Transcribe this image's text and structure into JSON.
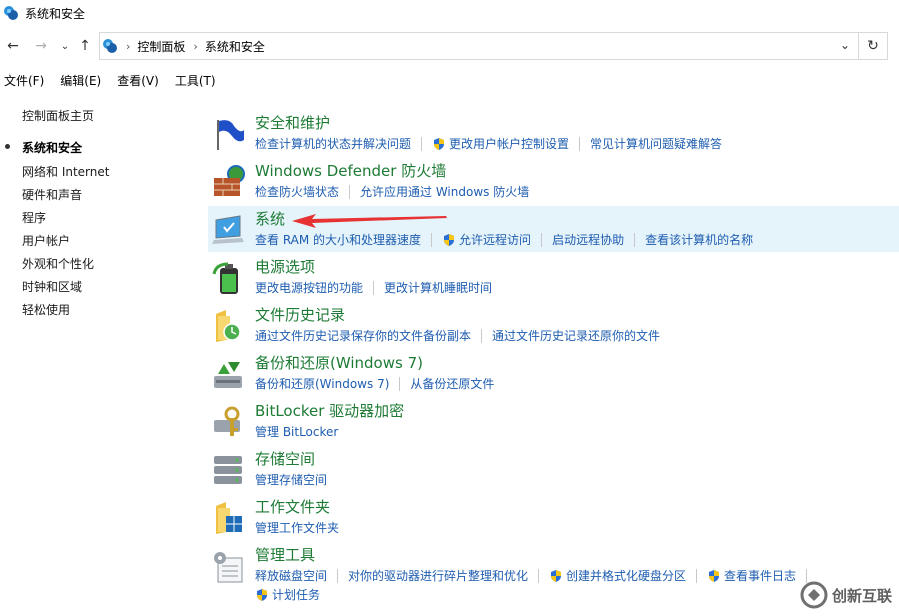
{
  "window": {
    "title": "系统和安全"
  },
  "nav": {
    "breadcrumb": [
      "控制面板",
      "系统和安全"
    ]
  },
  "menu": [
    "文件(F)",
    "编辑(E)",
    "查看(V)",
    "工具(T)"
  ],
  "sidebar": {
    "items": [
      "控制面板主页",
      "系统和安全",
      "网络和 Internet",
      "硬件和声音",
      "程序",
      "用户帐户",
      "外观和个性化",
      "时钟和区域",
      "轻松使用"
    ],
    "active_index": 1
  },
  "categories": [
    {
      "title": "安全和维护",
      "icon": "flag-icon",
      "links": [
        {
          "label": "检查计算机的状态并解决问题",
          "shield": false
        },
        {
          "label": "更改用户帐户控制设置",
          "shield": true
        },
        {
          "label": "常见计算机问题疑难解答",
          "shield": false
        }
      ]
    },
    {
      "title": "Windows Defender 防火墙",
      "icon": "firewall-icon",
      "links": [
        {
          "label": "检查防火墙状态",
          "shield": false
        },
        {
          "label": "允许应用通过 Windows 防火墙",
          "shield": false
        }
      ]
    },
    {
      "title": "系统",
      "icon": "computer-icon",
      "highlight": true,
      "links": [
        {
          "label": "查看 RAM 的大小和处理器速度",
          "shield": false
        },
        {
          "label": "允许远程访问",
          "shield": true
        },
        {
          "label": "启动远程协助",
          "shield": false
        },
        {
          "label": "查看该计算机的名称",
          "shield": false
        }
      ]
    },
    {
      "title": "电源选项",
      "icon": "battery-icon",
      "links": [
        {
          "label": "更改电源按钮的功能",
          "shield": false
        },
        {
          "label": "更改计算机睡眠时间",
          "shield": false
        }
      ]
    },
    {
      "title": "文件历史记录",
      "icon": "folder-clock-icon",
      "links": [
        {
          "label": "通过文件历史记录保存你的文件备份副本",
          "shield": false
        },
        {
          "label": "通过文件历史记录还原你的文件",
          "shield": false
        }
      ]
    },
    {
      "title": "备份和还原(Windows 7)",
      "icon": "backup-icon",
      "links": [
        {
          "label": "备份和还原(Windows 7)",
          "shield": false
        },
        {
          "label": "从备份还原文件",
          "shield": false
        }
      ]
    },
    {
      "title": "BitLocker 驱动器加密",
      "icon": "bitlocker-icon",
      "links": [
        {
          "label": "管理 BitLocker",
          "shield": false
        }
      ]
    },
    {
      "title": "存储空间",
      "icon": "storage-icon",
      "links": [
        {
          "label": "管理存储空间",
          "shield": false
        }
      ]
    },
    {
      "title": "工作文件夹",
      "icon": "work-folder-icon",
      "links": [
        {
          "label": "管理工作文件夹",
          "shield": false
        }
      ]
    },
    {
      "title": "管理工具",
      "icon": "admin-tools-icon",
      "links": [
        {
          "label": "释放磁盘空间",
          "shield": false
        },
        {
          "label": "对你的驱动器进行碎片整理和优化",
          "shield": false
        },
        {
          "label": "创建并格式化硬盘分区",
          "shield": true
        },
        {
          "label": "查看事件日志",
          "shield": true
        }
      ],
      "links_row2": [
        {
          "label": "计划任务",
          "shield": true
        }
      ]
    }
  ],
  "watermark": {
    "text": "创新互联"
  },
  "colors": {
    "title_green": "#1e7b35",
    "link_blue": "#1e5db0",
    "highlight": "#e5f3fb",
    "arrow_red": "#e63232"
  }
}
